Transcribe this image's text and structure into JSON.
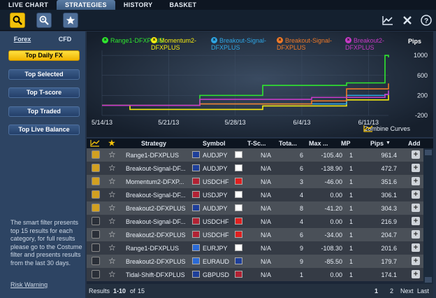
{
  "tabs": [
    "LIVE CHART",
    "STRATEGIES",
    "HISTORY",
    "BASKET"
  ],
  "left": {
    "subtabs": [
      "Forex",
      "CFD"
    ],
    "filters": [
      "Top Daily FX",
      "Top Selected",
      "Top T-score",
      "Top Traded",
      "Top Live Balance"
    ],
    "note": "The smart filter presents top 15 results for each category, for full results please go to the Costume filter and presents results from the last 30 days.",
    "risk": "Risk Warning"
  },
  "chart": {
    "legend": [
      {
        "name": "Range1-DFXPLUS",
        "color": "#2fe62f"
      },
      {
        "name": "Momentum2-DFXPLUS",
        "color": "#f5ea10"
      },
      {
        "name": "Breakout-Signal-DFXPLUS",
        "color": "#2ea6e6"
      },
      {
        "name": "Breakout-Signal-DFXPLUS",
        "color": "#f07a28"
      },
      {
        "name": "Breakout2-DFXPLUS",
        "color": "#c63ac6"
      }
    ],
    "y_title": "Pips",
    "y_ticks": [
      "1000",
      "600",
      "200",
      "-200"
    ],
    "x_ticks": [
      "5/14/13",
      "5/21/13",
      "5/28/13",
      "6/4/13",
      "6/11/13"
    ],
    "combine": "Combine Curves"
  },
  "chart_data": {
    "type": "line",
    "x": [
      "5/14/13",
      "5/21/13",
      "5/28/13",
      "6/4/13",
      "6/11/13"
    ],
    "ylabel": "Pips",
    "ylim": [
      -200,
      1100
    ],
    "series": [
      {
        "name": "Range1-DFXPLUS",
        "values": [
          0,
          0,
          200,
          400,
          400,
          450,
          1000,
          960
        ]
      },
      {
        "name": "Momentum2-DFXPLUS",
        "values": [
          0,
          -80,
          -80,
          -10,
          -10,
          110,
          110,
          220
        ]
      },
      {
        "name": "Breakout-Signal-DFXPLUS",
        "values": [
          0,
          0,
          30,
          30,
          30,
          200,
          220,
          280
        ]
      },
      {
        "name": "Breakout-Signal-DFXPLUS",
        "values": [
          0,
          0,
          30,
          30,
          90,
          330,
          330,
          440
        ]
      },
      {
        "name": "Breakout2-DFXPLUS",
        "values": [
          0,
          0,
          120,
          120,
          160,
          160,
          220,
          300
        ]
      }
    ]
  },
  "table": {
    "headers": [
      "Strategy",
      "Symbol",
      "T-Sc...",
      "Tota...",
      "Max ...",
      "MP",
      "Pips",
      "Add"
    ],
    "rows": [
      {
        "strategy": "Range1-DFXPLUS",
        "symbol": "AUDJPY",
        "tscore": "N/A",
        "total": "6",
        "max": "-105.40",
        "mp": "1",
        "pips": "961.4",
        "f1": "#1e3f9a",
        "f2": "#ffffff",
        "g": "#d2a020"
      },
      {
        "strategy": "Breakout-Signal-DF...",
        "symbol": "AUDJPY",
        "tscore": "N/A",
        "total": "6",
        "max": "-138.90",
        "mp": "1",
        "pips": "472.7",
        "f1": "#1e3f9a",
        "f2": "#ffffff",
        "g": "#d2a020"
      },
      {
        "strategy": "Momentum2-DFXP...",
        "symbol": "USDCHF",
        "tscore": "N/A",
        "total": "3",
        "max": "-46.00",
        "mp": "1",
        "pips": "351.6",
        "f1": "#b22234",
        "f2": "#e02020",
        "g": "#d2a020"
      },
      {
        "strategy": "Breakout-Signal-DF...",
        "symbol": "USDJPY",
        "tscore": "N/A",
        "total": "4",
        "max": "0.00",
        "mp": "1",
        "pips": "306.1",
        "f1": "#b22234",
        "f2": "#ffffff",
        "g": "#d2a020"
      },
      {
        "strategy": "Breakout2-DFXPLUS",
        "symbol": "AUDJPY",
        "tscore": "N/A",
        "total": "8",
        "max": "-41.20",
        "mp": "1",
        "pips": "304.3",
        "f1": "#1e3f9a",
        "f2": "#ffffff",
        "g": "#d2a020"
      },
      {
        "strategy": "Breakout-Signal-DF...",
        "symbol": "USDCHF",
        "tscore": "N/A",
        "total": "4",
        "max": "0.00",
        "mp": "1",
        "pips": "216.9",
        "f1": "#b22234",
        "f2": "#e02020",
        "g": "#2a2f38"
      },
      {
        "strategy": "Breakout2-DFXPLUS",
        "symbol": "USDCHF",
        "tscore": "N/A",
        "total": "6",
        "max": "-34.00",
        "mp": "1",
        "pips": "204.7",
        "f1": "#b22234",
        "f2": "#e02020",
        "g": "#2a2f38"
      },
      {
        "strategy": "Range1-DFXPLUS",
        "symbol": "EURJPY",
        "tscore": "N/A",
        "total": "9",
        "max": "-108.30",
        "mp": "1",
        "pips": "201.6",
        "f1": "#2a6ad6",
        "f2": "#ffffff",
        "g": "#2a2f38"
      },
      {
        "strategy": "Breakout2-DFXPLUS",
        "symbol": "EURAUD",
        "tscore": "N/A",
        "total": "9",
        "max": "-85.50",
        "mp": "1",
        "pips": "179.7",
        "f1": "#2a6ad6",
        "f2": "#1e3f9a",
        "g": "#2a2f38"
      },
      {
        "strategy": "Tidal-Shift-DFXPLUS",
        "symbol": "GBPUSD",
        "tscore": "N/A",
        "total": "1",
        "max": "0.00",
        "mp": "1",
        "pips": "174.1",
        "f1": "#1e3f9a",
        "f2": "#b22234",
        "g": "#2a2f38"
      }
    ]
  },
  "footer": {
    "results": "Results",
    "range": "1-10",
    "of": "of",
    "total": "15",
    "pages": [
      "1",
      "2"
    ],
    "next": "Next",
    "last": "Last"
  },
  "colors": {
    "accent": "#f2c20a",
    "panel": "#2d4463"
  }
}
